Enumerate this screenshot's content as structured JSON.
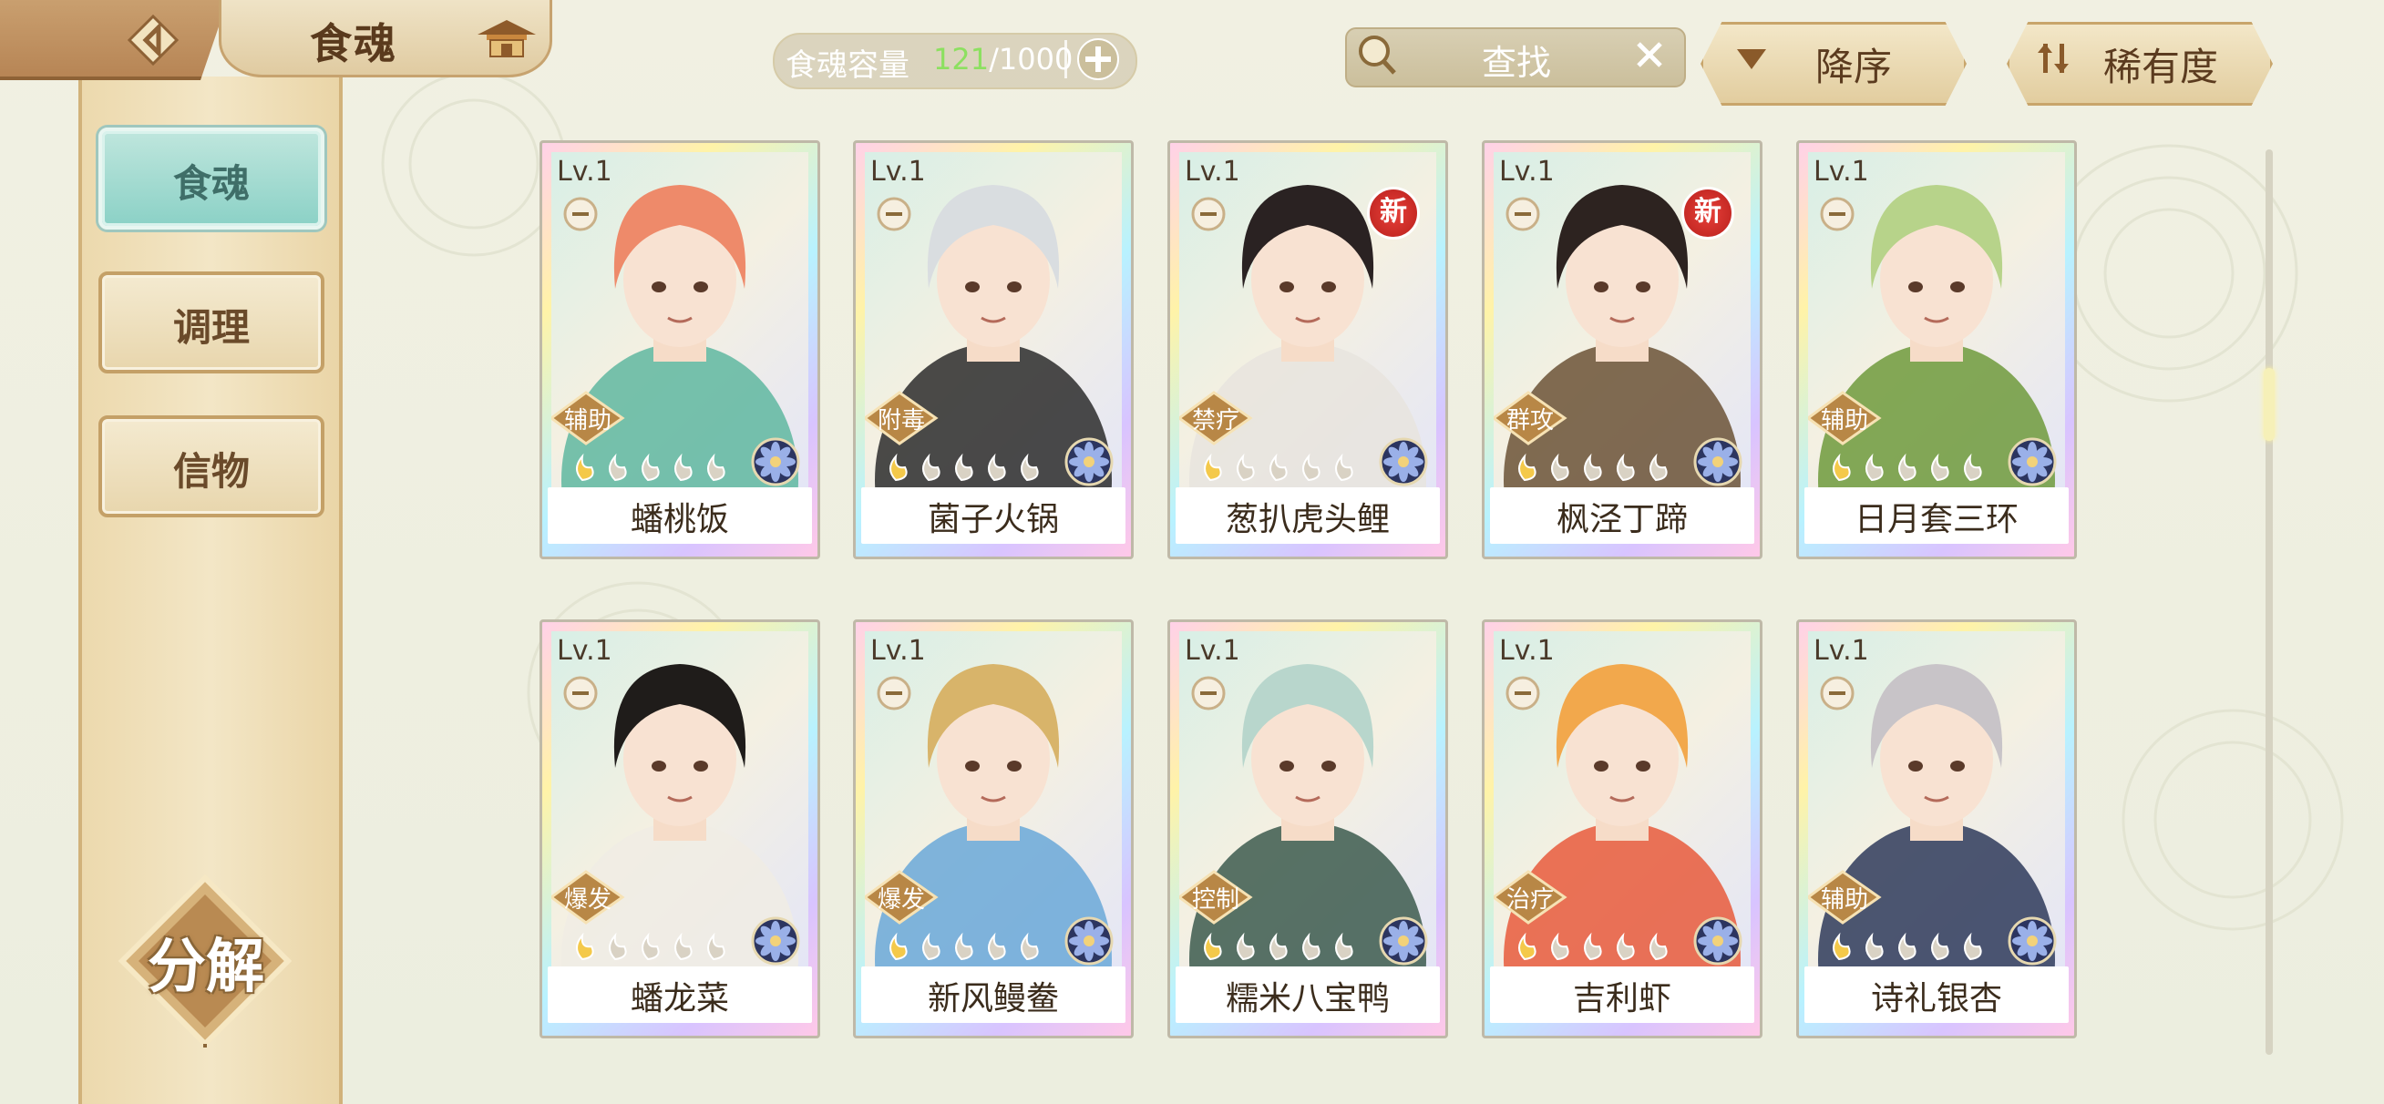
{
  "header": {
    "title": "食魂",
    "capacity_label": "食魂容量",
    "capacity_current": "121",
    "capacity_total": "/1000",
    "search_placeholder": "查找",
    "sort_order_label": "降序",
    "sort_field_label": "稀有度"
  },
  "sidebar": {
    "tabs": [
      {
        "label": "食魂",
        "active": true
      },
      {
        "label": "调理",
        "active": false
      },
      {
        "label": "信物",
        "active": false
      }
    ],
    "decompose_label": "分解"
  },
  "cards": [
    {
      "level": "Lv.1",
      "name": "蟠桃饭",
      "role": "辅助",
      "new": false,
      "hair": "#ee8a6a",
      "accent": "#5fb7a0"
    },
    {
      "level": "Lv.1",
      "name": "菌子火锅",
      "role": "附毒",
      "new": false,
      "hair": "#d9dde0",
      "accent": "#2c2c2c"
    },
    {
      "level": "Lv.1",
      "name": "葱扒虎头鲤",
      "role": "禁疗",
      "new": true,
      "new_label": "新",
      "hair": "#2a2222",
      "accent": "#e8e4de"
    },
    {
      "level": "Lv.1",
      "name": "枫泾丁蹄",
      "role": "群攻",
      "new": true,
      "new_label": "新",
      "hair": "#2d2320",
      "accent": "#6b5236"
    },
    {
      "level": "Lv.1",
      "name": "日月套三环",
      "role": "辅助",
      "new": false,
      "hair": "#b7d38a",
      "accent": "#6f9a3c"
    },
    {
      "level": "Lv.1",
      "name": "蟠龙菜",
      "role": "爆发",
      "new": false,
      "hair": "#1f1c1a",
      "accent": "#f0ece4"
    },
    {
      "level": "Lv.1",
      "name": "新风鳗鲞",
      "role": "爆发",
      "new": false,
      "hair": "#d8b46a",
      "accent": "#6aa8d8"
    },
    {
      "level": "Lv.1",
      "name": "糯米八宝鸭",
      "role": "控制",
      "new": false,
      "hair": "#b8d6cc",
      "accent": "#3c5a4e"
    },
    {
      "level": "Lv.1",
      "name": "吉利虾",
      "role": "治疗",
      "new": false,
      "hair": "#f2a84c",
      "accent": "#e85a3c"
    },
    {
      "level": "Lv.1",
      "name": "诗礼银杏",
      "role": "辅助",
      "new": false,
      "hair": "#c8c4c8",
      "accent": "#2e3a5a"
    }
  ]
}
